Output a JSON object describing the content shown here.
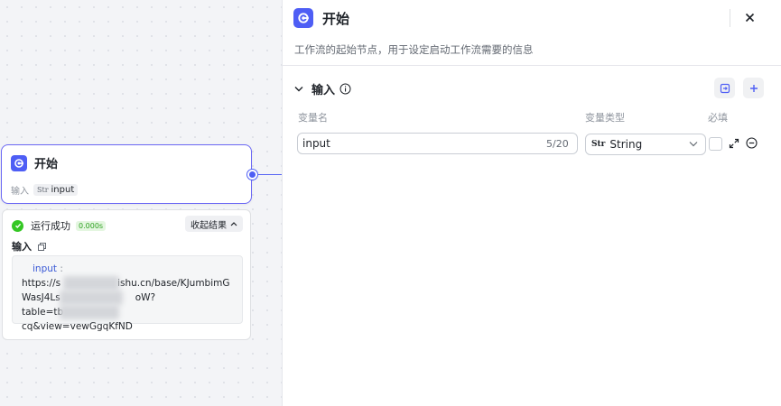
{
  "canvas": {
    "start_node": {
      "title": "开始",
      "io_label": "输入",
      "var_type_abbr": "Str",
      "var_name": "input"
    },
    "result": {
      "status": "运行成功",
      "duration": "0.000s",
      "collapse_label": "收起结果",
      "input_label": "输入",
      "input_key": "input",
      "input_colon": ":",
      "value_line1": "https://s",
      "value_line1_tail": "ishu.cn/base/KJumbimG",
      "value_line2": "WasJ4Ls",
      "value_line2_tail": "oW?",
      "value_line3": "table=tb",
      "value_line3_tail": "cq&view=vewGgqKfND"
    }
  },
  "panel": {
    "title": "开始",
    "description": "工作流的起始节点，用于设定启动工作流需要的信息",
    "section_title": "输入",
    "columns": {
      "name": "变量名",
      "type": "变量类型",
      "required": "必填"
    },
    "variable": {
      "name": "input",
      "counter": "5/20",
      "type_abbr": "Str",
      "type": "String",
      "required": false
    }
  },
  "colors": {
    "accent": "#4e5ef5",
    "node_border": "#6a67f4",
    "success": "#34c724",
    "edge": "#5a67f4"
  },
  "icons": {
    "node_icon": "workflow-start-icon",
    "close": "close-icon",
    "collapse": "chevron-down-icon",
    "info": "info-icon",
    "import": "import-icon",
    "add": "plus-icon",
    "expand": "expand-icon",
    "remove": "minus-circle-icon",
    "copy": "copy-icon",
    "success": "check-circle-icon"
  }
}
